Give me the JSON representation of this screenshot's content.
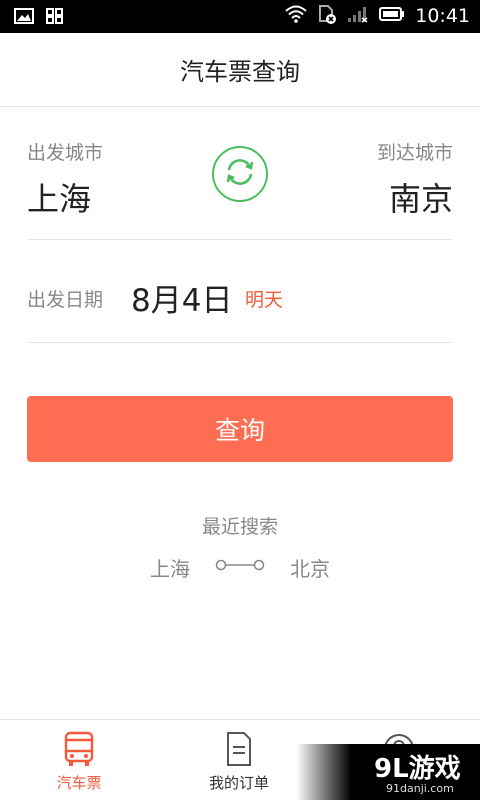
{
  "status_bar": {
    "time": "10:41",
    "icons": [
      "image-icon",
      "grid-apps-icon",
      "wifi-icon",
      "sim-icon",
      "signal-icon",
      "battery-icon"
    ]
  },
  "header": {
    "title": "汽车票查询"
  },
  "route": {
    "from_label": "出发城市",
    "from_city": "上海",
    "to_label": "到达城市",
    "to_city": "南京",
    "swap_icon": "swap-arrows-icon"
  },
  "date": {
    "label": "出发日期",
    "value": "8月4日",
    "hint": "明天"
  },
  "search_button": {
    "label": "查询"
  },
  "recent": {
    "title": "最近搜索",
    "items": [
      {
        "from": "上海",
        "to": "北京"
      }
    ]
  },
  "bottom_nav": {
    "items": [
      {
        "label": "汽车票",
        "icon": "bus-icon",
        "active": true
      },
      {
        "label": "我的订单",
        "icon": "document-icon",
        "active": false
      },
      {
        "label": "",
        "icon": "profile-icon",
        "active": false
      }
    ]
  },
  "watermark": {
    "logo": "9L游戏",
    "url": "91danji.com"
  },
  "colors": {
    "accent": "#ff6e52",
    "highlight_text": "#f25a3a",
    "swap_green": "#4cbd5f",
    "muted_text": "#888888"
  }
}
